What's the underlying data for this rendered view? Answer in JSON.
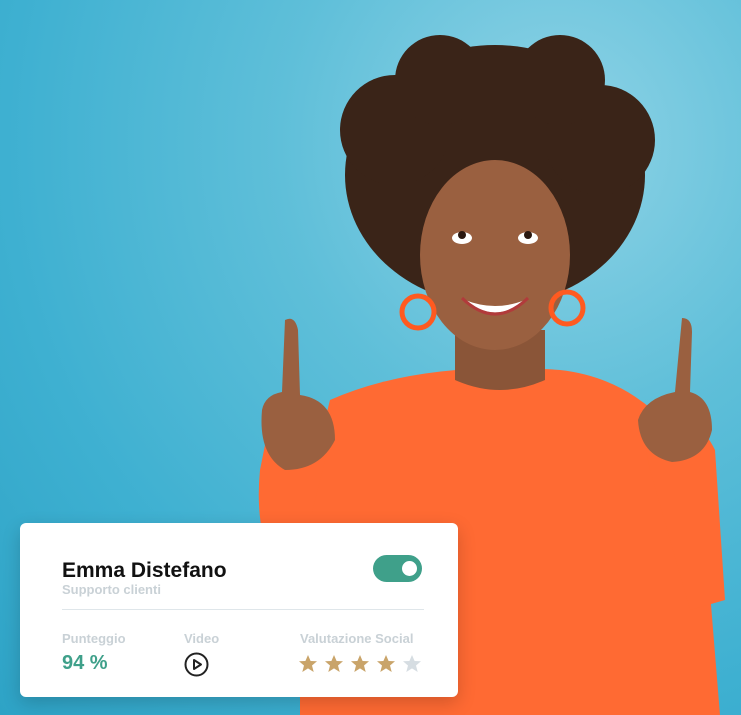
{
  "profile": {
    "name": "Emma Distefano",
    "role": "Supporto clienti",
    "toggle_on": true
  },
  "stats": {
    "score_label": "Punteggio",
    "score_value": "94 %",
    "video_label": "Video",
    "social_label": "Valutazione Social",
    "rating": 4,
    "rating_max": 5
  },
  "colors": {
    "accent": "#3fa08a",
    "star_filled": "#c9a46a",
    "star_empty": "#d6dde2",
    "background": "#3eb0d1"
  },
  "icons": [
    "play-icon",
    "star-icon",
    "toggle-switch"
  ]
}
